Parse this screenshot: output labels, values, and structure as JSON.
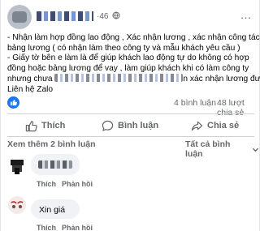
{
  "post": {
    "time": "46",
    "time_separator": "·",
    "more_icon": "…",
    "lines": [
      "- Nhận làm hợp đồng lao động , Xác nhận lương , xác nhận công tác ,",
      "bảng lương ( có nhận làm theo công ty và mẫu khách yêu cầu )",
      "- Giấy tờ bên e làm là để giúp khách lao động tự do không có hợp",
      "đồng hoặc bảng lương để vay , làm giúp khách khi có làm công ty"
    ],
    "line5_start": "nhưng chưa",
    "line5_end": "n xác nhận lương được",
    "line6": "Liên hệ Zalo"
  },
  "stats": {
    "reaction_icon": "like-icon",
    "comments": "4 bình luận",
    "shares": "48 lượt chia sẻ"
  },
  "actions": {
    "like": "Thích",
    "comment": "Bình luận",
    "share": "Chia sẻ"
  },
  "comments_header": {
    "more": "Xem thêm 2 bình luận",
    "filter": "Tất cả bình luận"
  },
  "comments": [
    {
      "text": "",
      "like_label": "Thích",
      "reply_label": "Phản hồi"
    },
    {
      "text": "Xin giá",
      "like_label": "Thích",
      "reply_label": "Phản hồi"
    }
  ],
  "colors": {
    "accent": "#1877f2",
    "muted_text": "#65676b",
    "bubble": "#f0f2f5",
    "divider": "#ced0d4"
  }
}
